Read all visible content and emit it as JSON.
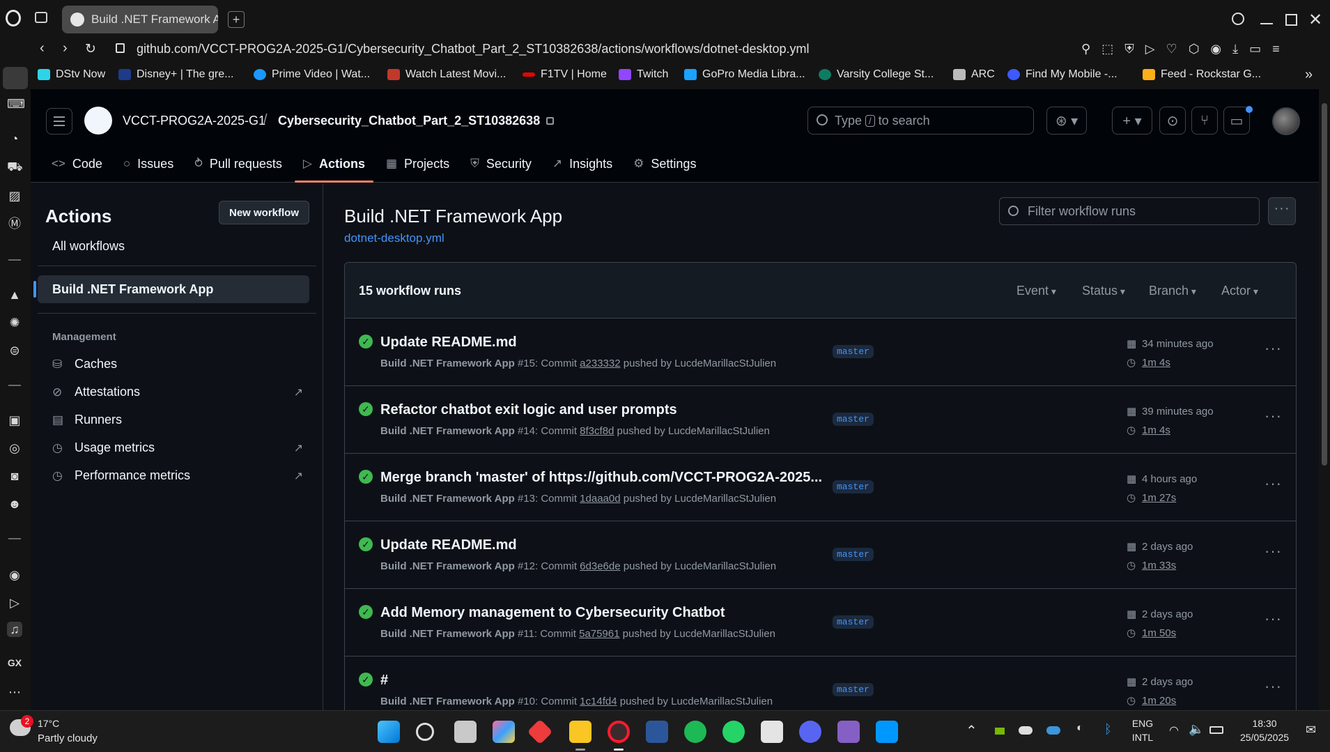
{
  "browser": {
    "tab_title": "Build .NET Framework App",
    "url": "github.com/VCCT-PROG2A-2025-G1/Cybersecurity_Chatbot_Part_2_ST10382638/actions/workflows/dotnet-desktop.yml",
    "bookmarks": [
      {
        "label": "DStv Now",
        "color": "#2dd4e8"
      },
      {
        "label": "Disney+ | The gre...",
        "color": "#1e3a8a"
      },
      {
        "label": "Prime Video | Wat...",
        "color": "#1a98ff"
      },
      {
        "label": "Watch Latest Movi...",
        "color": "#c0392b"
      },
      {
        "label": "F1TV | Home",
        "color": "#e10600"
      },
      {
        "label": "Twitch",
        "color": "#9146ff"
      },
      {
        "label": "GoPro Media Libra...",
        "color": "#1aa3ff"
      },
      {
        "label": "Varsity College St...",
        "color": "#0e7c61"
      },
      {
        "label": "ARC",
        "color": "#bbbbbb"
      },
      {
        "label": "Find My Mobile -...",
        "color": "#3d5afe"
      },
      {
        "label": "Feed - Rockstar G...",
        "color": "#fcaf17"
      }
    ]
  },
  "header": {
    "owner": "VCCT-PROG2A-2025-G1",
    "separator": "/",
    "repo": "Cybersecurity_Chatbot_Part_2_ST10382638",
    "search_prefix": "Type",
    "search_key": "/",
    "search_suffix": "to search"
  },
  "repo_nav": [
    {
      "label": "Code",
      "icon": "<>"
    },
    {
      "label": "Issues",
      "icon": "○"
    },
    {
      "label": "Pull requests",
      "icon": "⥁"
    },
    {
      "label": "Actions",
      "icon": "▷"
    },
    {
      "label": "Projects",
      "icon": "▦"
    },
    {
      "label": "Security",
      "icon": "⛨"
    },
    {
      "label": "Insights",
      "icon": "↗"
    },
    {
      "label": "Settings",
      "icon": "⚙"
    }
  ],
  "sidebar": {
    "title": "Actions",
    "new_workflow": "New workflow",
    "all_workflows": "All workflows",
    "selected_workflow": "Build .NET Framework App",
    "management_label": "Management",
    "links": [
      {
        "label": "Caches",
        "external": ""
      },
      {
        "label": "Attestations",
        "external": "↗"
      },
      {
        "label": "Runners",
        "external": ""
      },
      {
        "label": "Usage metrics",
        "external": "↗"
      },
      {
        "label": "Performance metrics",
        "external": "↗"
      }
    ]
  },
  "main": {
    "title": "Build .NET Framework App",
    "file": "dotnet-desktop.yml",
    "filter_placeholder": "Filter workflow runs",
    "runs_count": "15 workflow runs",
    "filters": [
      "Event",
      "Status",
      "Branch",
      "Actor"
    ],
    "runs": [
      {
        "title": "Update README.md",
        "workflow": "Build .NET Framework App",
        "number": "#15",
        "commit": "a233332",
        "actor": "LucdeMarillacStJulien",
        "branch": "master",
        "time": "34 minutes ago",
        "duration": "1m 4s"
      },
      {
        "title": "Refactor chatbot exit logic and user prompts",
        "workflow": "Build .NET Framework App",
        "number": "#14",
        "commit": "8f3cf8d",
        "actor": "LucdeMarillacStJulien",
        "branch": "master",
        "time": "39 minutes ago",
        "duration": "1m 4s"
      },
      {
        "title": "Merge branch 'master' of https://github.com/VCCT-PROG2A-2025...",
        "workflow": "Build .NET Framework App",
        "number": "#13",
        "commit": "1daaa0d",
        "actor": "LucdeMarillacStJulien",
        "branch": "master",
        "time": "4 hours ago",
        "duration": "1m 27s"
      },
      {
        "title": "Update README.md",
        "workflow": "Build .NET Framework App",
        "number": "#12",
        "commit": "6d3e6de",
        "actor": "LucdeMarillacStJulien",
        "branch": "master",
        "time": "2 days ago",
        "duration": "1m 33s"
      },
      {
        "title": "Add Memory management to Cybersecurity Chatbot",
        "workflow": "Build .NET Framework App",
        "number": "#11",
        "commit": "5a75961",
        "actor": "LucdeMarillacStJulien",
        "branch": "master",
        "time": "2 days ago",
        "duration": "1m 50s"
      },
      {
        "title": "#",
        "workflow": "Build .NET Framework App",
        "number": "#10",
        "commit": "1c14fd4",
        "actor": "LucdeMarillacStJulien",
        "branch": "master",
        "time": "2 days ago",
        "duration": "1m 20s"
      }
    ]
  },
  "taskbar": {
    "temperature": "17°C",
    "weather": "Partly cloudy",
    "notifications": "2",
    "lang_top": "ENG",
    "lang_bottom": "INTL",
    "time": "18:30",
    "date": "25/05/2025"
  }
}
